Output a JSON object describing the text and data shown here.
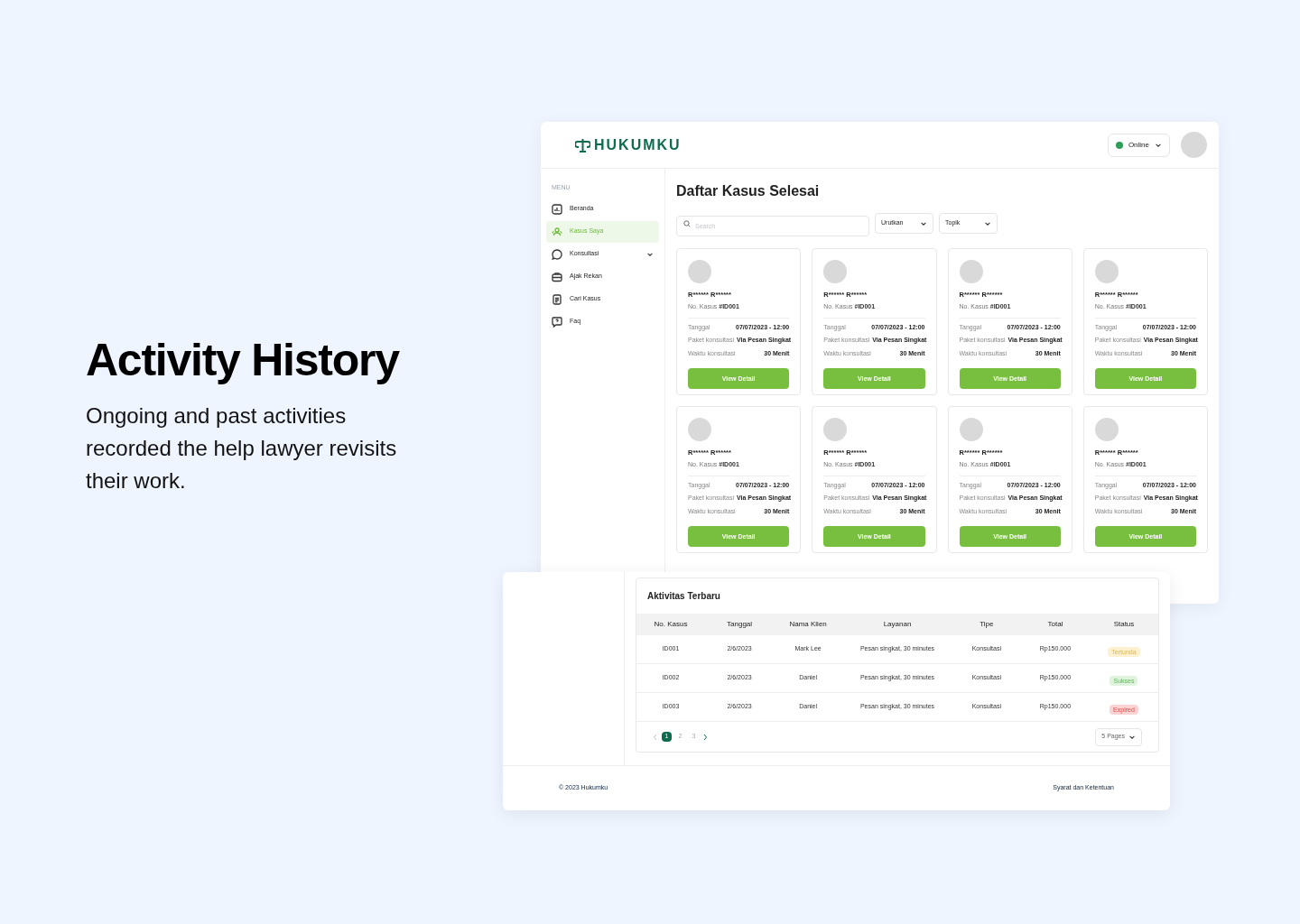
{
  "hero": {
    "title": "Activity History",
    "description": "Ongoing and past activities recorded the help lawyer revisits their work."
  },
  "app": {
    "logo": "HUKUMKU",
    "status": "Online",
    "menu_label": "MENU",
    "menu": [
      {
        "label": "Beranda",
        "selected": false
      },
      {
        "label": "Kasus Saya",
        "selected": true
      },
      {
        "label": "Konsultasi",
        "selected": false,
        "expandable": true
      },
      {
        "label": "Ajak Rekan",
        "selected": false
      },
      {
        "label": "Cari Kasus",
        "selected": false
      },
      {
        "label": "Faq",
        "selected": false
      }
    ],
    "page_title": "Daftar Kasus Selesai",
    "search": {
      "placeholder": "Search"
    },
    "filters": [
      "Urutkan",
      "Topik"
    ],
    "cards": [
      {
        "name": "R****** R******",
        "case_prefix": "No. Kasus ",
        "case_id": "#ID001",
        "fields": [
          {
            "label": "Tanggal",
            "value": "07/07/2023 - 12:00"
          },
          {
            "label": "Paket konsultasi",
            "value": "Via Pesan Singkat"
          },
          {
            "label": "Waktu konsultasi",
            "value": "30 Menit"
          }
        ],
        "button": "View Detail"
      },
      {
        "name": "R****** R******",
        "case_prefix": "No. Kasus ",
        "case_id": "#ID001",
        "fields": [
          {
            "label": "Tanggal",
            "value": "07/07/2023 - 12:00"
          },
          {
            "label": "Paket konsultasi",
            "value": "Via Pesan Singkat"
          },
          {
            "label": "Waktu konsultasi",
            "value": "30 Menit"
          }
        ],
        "button": "View Detail"
      },
      {
        "name": "R****** R******",
        "case_prefix": "No. Kasus ",
        "case_id": "#ID001",
        "fields": [
          {
            "label": "Tanggal",
            "value": "07/07/2023 - 12:00"
          },
          {
            "label": "Paket konsultasi",
            "value": "Via Pesan Singkat"
          },
          {
            "label": "Waktu konsultasi",
            "value": "30 Menit"
          }
        ],
        "button": "View Detail"
      },
      {
        "name": "R****** R******",
        "case_prefix": "No. Kasus ",
        "case_id": "#ID001",
        "fields": [
          {
            "label": "Tanggal",
            "value": "07/07/2023 - 12:00"
          },
          {
            "label": "Paket konsultasi",
            "value": "Via Pesan Singkat"
          },
          {
            "label": "Waktu konsultasi",
            "value": "30 Menit"
          }
        ],
        "button": "View Detail"
      },
      {
        "name": "R****** R******",
        "case_prefix": "No. Kasus ",
        "case_id": "#ID001",
        "fields": [
          {
            "label": "Tanggal",
            "value": "07/07/2023 - 12:00"
          },
          {
            "label": "Paket konsultasi",
            "value": "Via Pesan Singkat"
          },
          {
            "label": "Waktu konsultasi",
            "value": "30 Menit"
          }
        ],
        "button": "View Detail"
      },
      {
        "name": "R****** R******",
        "case_prefix": "No. Kasus ",
        "case_id": "#ID001",
        "fields": [
          {
            "label": "Tanggal",
            "value": "07/07/2023 - 12:00"
          },
          {
            "label": "Paket konsultasi",
            "value": "Via Pesan Singkat"
          },
          {
            "label": "Waktu konsultasi",
            "value": "30 Menit"
          }
        ],
        "button": "View Detail"
      },
      {
        "name": "R****** R******",
        "case_prefix": "No. Kasus ",
        "case_id": "#ID001",
        "fields": [
          {
            "label": "Tanggal",
            "value": "07/07/2023 - 12:00"
          },
          {
            "label": "Paket konsultasi",
            "value": "Via Pesan Singkat"
          },
          {
            "label": "Waktu konsultasi",
            "value": "30 Menit"
          }
        ],
        "button": "View Detail"
      },
      {
        "name": "R****** R******",
        "case_prefix": "No. Kasus ",
        "case_id": "#ID001",
        "fields": [
          {
            "label": "Tanggal",
            "value": "07/07/2023 - 12:00"
          },
          {
            "label": "Paket konsultasi",
            "value": "Via Pesan Singkat"
          },
          {
            "label": "Waktu konsultasi",
            "value": "30 Menit"
          }
        ],
        "button": "View Detail"
      }
    ]
  },
  "activity": {
    "title": "Aktivitas Terbaru",
    "columns": [
      "No. Kasus",
      "Tanggal",
      "Nama Klien",
      "Layanan",
      "Tipe",
      "Total",
      "Status"
    ],
    "rows": [
      {
        "cells": [
          "ID001",
          "2/6/2023",
          "Mark Lee",
          "Pesan singkat, 30 minutes",
          "Konsultasi",
          "Rp150.000"
        ],
        "status": {
          "label": "Tertunda",
          "kind": "pending"
        }
      },
      {
        "cells": [
          "ID002",
          "2/6/2023",
          "Daniel",
          "Pesan singkat, 30 minutes",
          "Konsultasi",
          "Rp150.000"
        ],
        "status": {
          "label": "Sukses",
          "kind": "success"
        }
      },
      {
        "cells": [
          "ID003",
          "2/6/2023",
          "Daniel",
          "Pesan singkat, 30 minutes",
          "Konsultasi",
          "Rp150.000"
        ],
        "status": {
          "label": "Expired",
          "kind": "expired"
        }
      }
    ],
    "pages": [
      {
        "label": "1",
        "selected": true
      },
      {
        "label": "2",
        "selected": false
      },
      {
        "label": "3",
        "selected": false
      }
    ],
    "page_size": "5 Pages"
  },
  "footer": {
    "copyright": "© 2023 Hukumku",
    "link": "Syarat dan Ketentuan"
  }
}
